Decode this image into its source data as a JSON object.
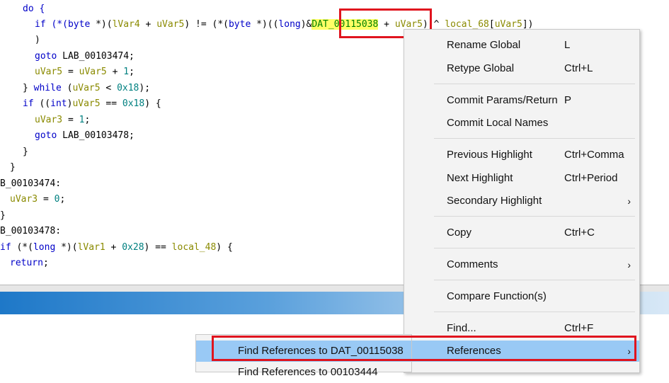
{
  "code": {
    "l0": "do {",
    "l1": {
      "a": "if (*(",
      "t1": "byte",
      "b": " *)(",
      "v1": "lVar4",
      "c": " + ",
      "v2": "uVar5",
      "d": ") != (*(",
      "t2": "byte",
      "e": " *)((",
      "t3": "long",
      "f": ")&",
      "g": "DAT_00115038",
      "h": " + ",
      "v3": "uVar5",
      "i": ") ^ ",
      "v4": "local_68",
      "j": "[",
      "v5": "uVar5",
      "k": "])"
    },
    "l2": ")",
    "l3": {
      "a": "goto ",
      "b": "LAB_00103474;"
    },
    "l4": {
      "v": "uVar5",
      "a": " = ",
      "v2": "uVar5",
      "b": " + ",
      "n": "1",
      "c": ";"
    },
    "l5": {
      "a": "} ",
      "kw": "while",
      "b": " (",
      "v": "uVar5",
      "c": " < ",
      "n": "0x18",
      "d": ");"
    },
    "l6": {
      "kw": "if",
      "a": " ((",
      "t": "int",
      "b": ")",
      "v": "uVar5",
      "c": " == ",
      "n": "0x18",
      "d": ") {"
    },
    "l7": {
      "v": "uVar3",
      "a": " = ",
      "n": "1",
      "b": ";"
    },
    "l8": {
      "a": "goto ",
      "b": "LAB_00103478;"
    },
    "l9": "}",
    "l10": "}",
    "l11": "B_00103474:",
    "l12": {
      "v": "uVar3",
      "a": " = ",
      "n": "0",
      "b": ";"
    },
    "l13": "}",
    "l14": "B_00103478:",
    "l15": {
      "kw": "if",
      "a": " (*(",
      "t": "long",
      "b": " *)(",
      "v": "lVar1",
      "c": " + ",
      "n": "0x28",
      "d": ") == ",
      "v2": "local_48",
      "e": ") {"
    },
    "l16": {
      "kw": "return",
      "a": ";"
    }
  },
  "context_menu": {
    "items": [
      {
        "label": "Rename Global",
        "shortcut": "L"
      },
      {
        "label": "Retype Global",
        "shortcut": "Ctrl+L"
      },
      {
        "label": "Commit Params/Return",
        "shortcut": "P"
      },
      {
        "label": "Commit Local Names",
        "shortcut": ""
      },
      {
        "label": "Previous Highlight",
        "shortcut": "Ctrl+Comma"
      },
      {
        "label": "Next Highlight",
        "shortcut": "Ctrl+Period"
      },
      {
        "label": "Secondary Highlight",
        "shortcut": ""
      },
      {
        "label": "Copy",
        "shortcut": "Ctrl+C"
      },
      {
        "label": "Comments",
        "shortcut": ""
      },
      {
        "label": "Compare Function(s)",
        "shortcut": ""
      },
      {
        "label": "Find...",
        "shortcut": "Ctrl+F"
      },
      {
        "label": "References",
        "shortcut": ""
      }
    ],
    "arrow": "›"
  },
  "submenu": {
    "item1": "Find References to DAT_00115038",
    "item2": "Find References to 00103444"
  },
  "colors": {
    "selection": "#99c9f5",
    "highlight": "#e0141e"
  }
}
